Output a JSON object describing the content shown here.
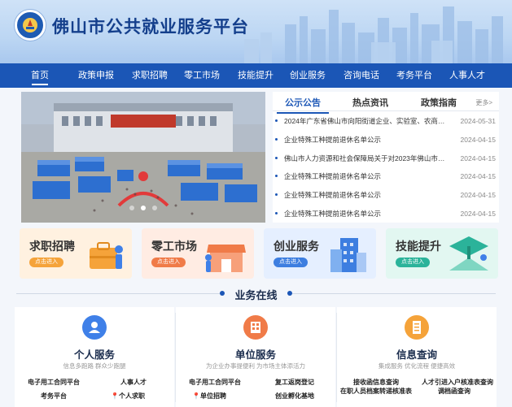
{
  "header": {
    "title": "佛山市公共就业服务平台",
    "logo_icon": "emblem-icon"
  },
  "nav": {
    "items": [
      "首页",
      "政策申报",
      "求职招聘",
      "零工市场",
      "技能提升",
      "创业服务",
      "咨询电话",
      "考务平台",
      "人事人才"
    ],
    "active_index": 0
  },
  "news": {
    "tabs": [
      "公示公告",
      "热点资讯",
      "政策指南"
    ],
    "active_tab": 0,
    "more": "更多>",
    "items": [
      {
        "title": "2024年广东省佛山市向阳街道企业、实验室、农商行、医院和社区...",
        "date": "2024-05-31"
      },
      {
        "title": "企业特殊工种提前退休名单公示",
        "date": "2024-04-15"
      },
      {
        "title": "佛山市人力资源和社会保障局关于对2023年佛山市企业首席...",
        "date": "2024-04-15"
      },
      {
        "title": "企业特殊工种提前退休名单公示",
        "date": "2024-04-15"
      },
      {
        "title": "企业特殊工种提前退休名单公示",
        "date": "2024-04-15"
      },
      {
        "title": "企业特殊工种提前退休名单公示",
        "date": "2024-04-15"
      }
    ]
  },
  "carousel": {
    "slides": 3,
    "active_slide": 1
  },
  "cards": [
    {
      "title": "求职招聘",
      "button": "点击进入",
      "color": "#f5a33a",
      "bg": "#fff1e0",
      "icon": "briefcase-icon"
    },
    {
      "title": "零工市场",
      "button": "点击进入",
      "color": "#f07b48",
      "bg": "#ffece3",
      "icon": "shop-icon"
    },
    {
      "title": "创业服务",
      "button": "点击进入",
      "color": "#3d7ee0",
      "bg": "#e5efff",
      "icon": "building-icon"
    },
    {
      "title": "技能提升",
      "button": "点击进入",
      "color": "#2bb39a",
      "bg": "#e2f7f1",
      "icon": "skill-icon"
    }
  ],
  "business": {
    "title": "业务在线",
    "columns": [
      {
        "title": "个人服务",
        "subtitle": "信息多跑路 群众少跑腿",
        "color": "#3f80e8",
        "icon": "person-icon",
        "links": [
          "电子用工合同平台",
          "人事人才",
          "考务平台",
          "个人求职"
        ]
      },
      {
        "title": "单位服务",
        "subtitle": "为企业办事提便利 为市场主体添活力",
        "color": "#f07b48",
        "icon": "building-icon",
        "links": [
          "电子用工合同平台",
          "复工返岗登记",
          "单位招聘",
          "创业孵化基地"
        ]
      },
      {
        "title": "信息查询",
        "subtitle": "集成服务 优化流程 便捷高效",
        "color": "#f5a33a",
        "icon": "document-icon",
        "links": [
          "接收函信息查询",
          "人才引进入户核准表查询",
          "在职人员档案转递核准表",
          "调档函查询"
        ]
      }
    ]
  }
}
